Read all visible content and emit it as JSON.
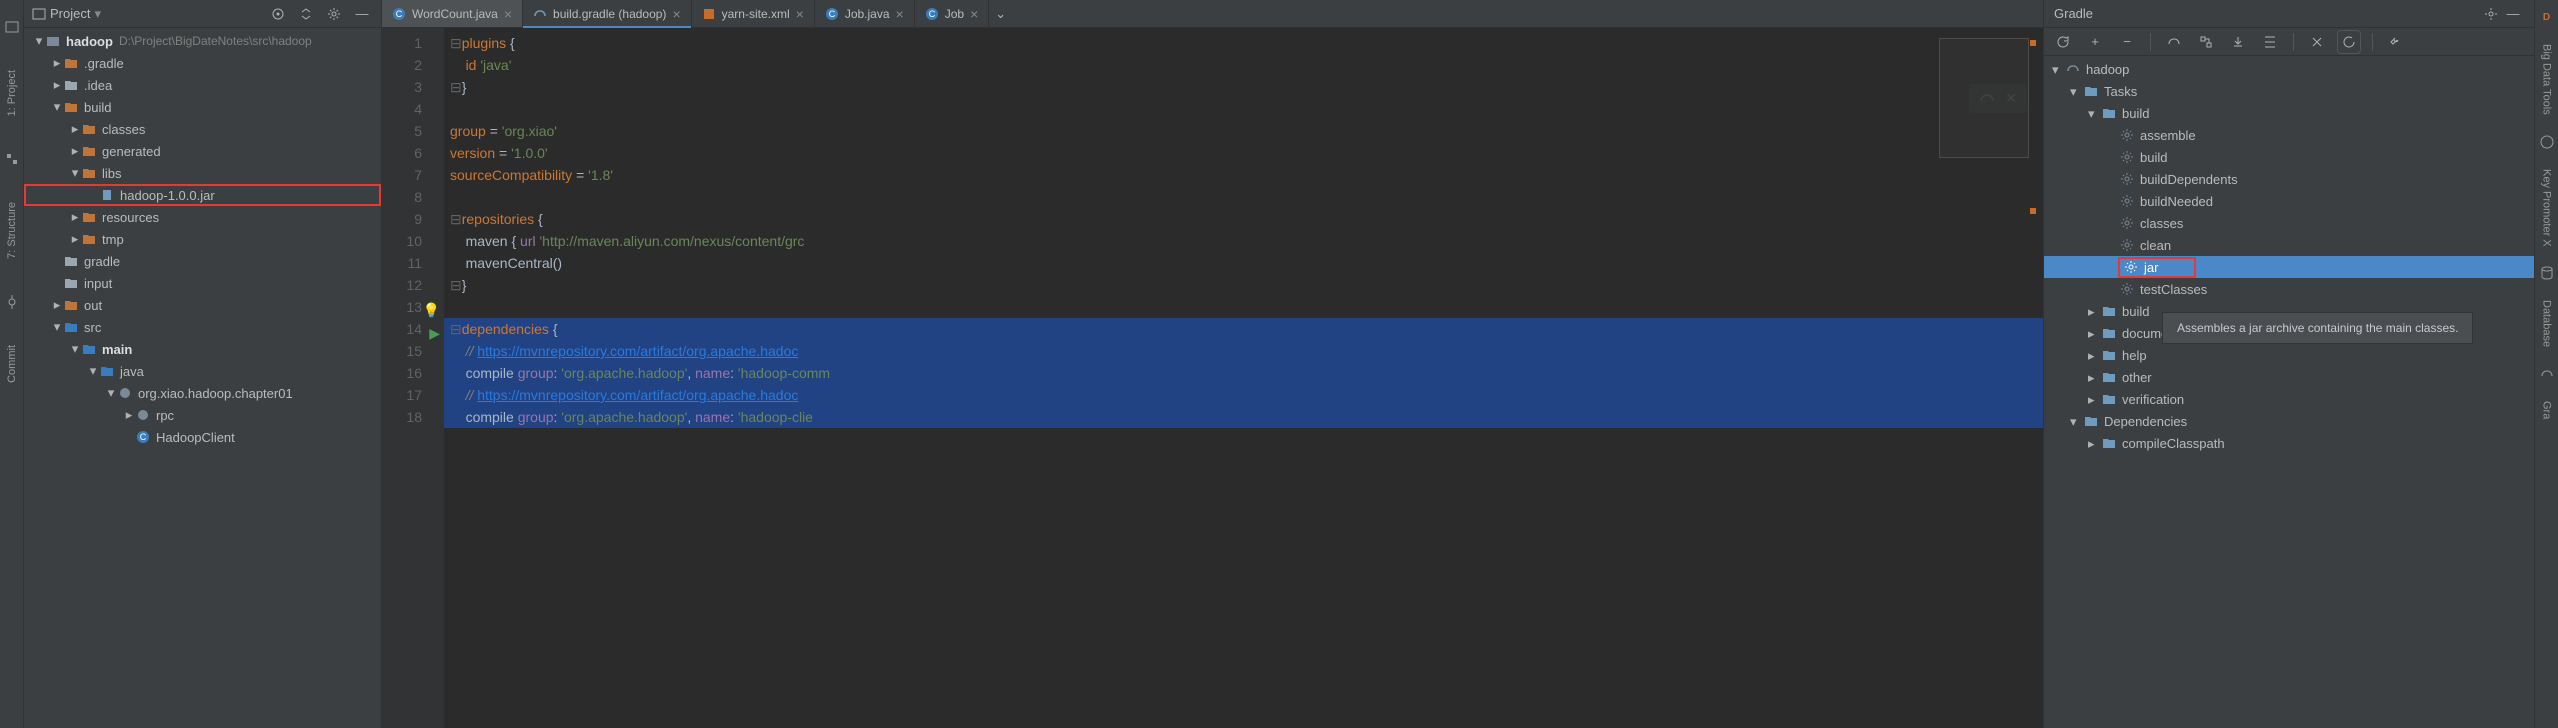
{
  "leftStripe": {
    "project": "1: Project",
    "structure": "7: Structure",
    "commit": "Commit"
  },
  "projectPanel": {
    "title": "Project",
    "root": {
      "name": "hadoop",
      "path": "D:\\Project\\BigDateNotes\\src\\hadoop"
    },
    "tree": [
      {
        "depth": 1,
        "exp": "right",
        "icon": "folder",
        "label": ".gradle",
        "color": "#c07437"
      },
      {
        "depth": 1,
        "exp": "right",
        "icon": "folder",
        "label": ".idea",
        "color": "#9aa7b0"
      },
      {
        "depth": 1,
        "exp": "down",
        "icon": "folder",
        "label": "build",
        "color": "#c07437"
      },
      {
        "depth": 2,
        "exp": "right",
        "icon": "folder",
        "label": "classes",
        "color": "#c07437"
      },
      {
        "depth": 2,
        "exp": "right",
        "icon": "folder",
        "label": "generated",
        "color": "#c07437"
      },
      {
        "depth": 2,
        "exp": "down",
        "icon": "folder",
        "label": "libs",
        "color": "#c07437"
      },
      {
        "depth": 3,
        "exp": "none",
        "icon": "jar",
        "label": "hadoop-1.0.0.jar",
        "hl": true
      },
      {
        "depth": 2,
        "exp": "right",
        "icon": "folder",
        "label": "resources",
        "color": "#c07437"
      },
      {
        "depth": 2,
        "exp": "right",
        "icon": "folder",
        "label": "tmp",
        "color": "#c07437"
      },
      {
        "depth": 1,
        "exp": "",
        "icon": "folder",
        "label": "gradle",
        "color": "#9aa7b0"
      },
      {
        "depth": 1,
        "exp": "",
        "icon": "folder",
        "label": "input",
        "color": "#9aa7b0"
      },
      {
        "depth": 1,
        "exp": "right",
        "icon": "folder",
        "label": "out",
        "color": "#c07437"
      },
      {
        "depth": 1,
        "exp": "down",
        "icon": "source",
        "label": "src",
        "color": "#3a7dbf"
      },
      {
        "depth": 2,
        "exp": "down",
        "icon": "source",
        "label": "main",
        "color": "#3a7dbf",
        "bold": true
      },
      {
        "depth": 3,
        "exp": "down",
        "icon": "source",
        "label": "java",
        "color": "#3a7dbf"
      },
      {
        "depth": 4,
        "exp": "down",
        "icon": "package",
        "label": "org.xiao.hadoop.chapter01"
      },
      {
        "depth": 5,
        "exp": "right",
        "icon": "package",
        "label": "rpc"
      },
      {
        "depth": 5,
        "exp": "none",
        "icon": "class",
        "label": "HadoopClient"
      }
    ]
  },
  "tabs": [
    {
      "icon": "class",
      "label": "WordCount.java",
      "active": true
    },
    {
      "icon": "gradle",
      "label": "build.gradle (hadoop)",
      "underline": true
    },
    {
      "icon": "xml",
      "label": "yarn-site.xml"
    },
    {
      "icon": "class",
      "label": "Job.java"
    },
    {
      "icon": "class",
      "label": "Job"
    }
  ],
  "code": {
    "lines": [
      {
        "n": 1,
        "html": "<span class='fold'>⊟</span><span class='kw'>plugins</span> <span class='plain'>{</span>"
      },
      {
        "n": 2,
        "html": "    <span class='kw'>id</span> <span class='str'>'java'</span>"
      },
      {
        "n": 3,
        "html": "<span class='fold'>⊟</span><span class='plain'>}</span>"
      },
      {
        "n": 4,
        "html": ""
      },
      {
        "n": 5,
        "html": "<span class='kw'>group</span> <span class='plain'>=</span> <span class='str'>'org.xiao'</span>"
      },
      {
        "n": 6,
        "html": "<span class='kw'>version</span> <span class='plain'>=</span> <span class='str'>'1.0.0'</span>"
      },
      {
        "n": 7,
        "html": "<span class='kw'>sourceCompatibility</span> <span class='plain'>=</span> <span class='str'>'1.8'</span>"
      },
      {
        "n": 8,
        "html": ""
      },
      {
        "n": 9,
        "html": "<span class='fold'>⊟</span><span class='kw'>repositories</span> <span class='plain'>{</span>"
      },
      {
        "n": 10,
        "html": "    <span class='plain'>maven { </span><span class='id'>url</span> <span class='str'>'http://maven.aliyun.com/nexus/content/grc</span>"
      },
      {
        "n": 11,
        "html": "    <span class='plain'>mavenCentral()</span>"
      },
      {
        "n": 12,
        "html": "<span class='fold'>⊟</span><span class='plain'>}</span>"
      },
      {
        "n": 13,
        "html": "",
        "bulb": true
      },
      {
        "n": 14,
        "html": "<span class='fold'>⊟</span><span class='kw'>dependencies</span> <span class='plain'>{</span>",
        "play": true,
        "sel": true
      },
      {
        "n": 15,
        "html": "    <span class='com'>// </span><span class='lnk'>https://mvnrepository.com/artifact/org.apache.hadoc</span>",
        "sel": true
      },
      {
        "n": 16,
        "html": "    <span class='plain'>compile </span><span class='id'>group</span><span class='plain'>: </span><span class='str'>'org.apache.hadoop'</span><span class='plain'>, </span><span class='id'>name</span><span class='plain'>: </span><span class='str'>'hadoop-comm</span>",
        "sel": true
      },
      {
        "n": 17,
        "html": "    <span class='com'>// </span><span class='lnk'>https://mvnrepository.com/artifact/org.apache.hadoc</span>",
        "sel": true
      },
      {
        "n": 18,
        "html": "    <span class='plain'>compile </span><span class='id'>group</span><span class='plain'>: </span><span class='str'>'org.apache.hadoop'</span><span class='plain'>, </span><span class='id'>name</span><span class='plain'>: </span><span class='str'>'hadoop-clie</span>",
        "sel": true
      }
    ]
  },
  "gradle": {
    "title": "Gradle",
    "tree": [
      {
        "depth": 0,
        "exp": "down",
        "icon": "elephant",
        "label": "hadoop"
      },
      {
        "depth": 1,
        "exp": "down",
        "icon": "folder-gear",
        "label": "Tasks"
      },
      {
        "depth": 2,
        "exp": "down",
        "icon": "folder-gear",
        "label": "build"
      },
      {
        "depth": 3,
        "icon": "gear",
        "label": "assemble"
      },
      {
        "depth": 3,
        "icon": "gear",
        "label": "build"
      },
      {
        "depth": 3,
        "icon": "gear",
        "label": "buildDependents"
      },
      {
        "depth": 3,
        "icon": "gear",
        "label": "buildNeeded"
      },
      {
        "depth": 3,
        "icon": "gear",
        "label": "classes"
      },
      {
        "depth": 3,
        "icon": "gear",
        "label": "clean"
      },
      {
        "depth": 3,
        "icon": "gear",
        "label": "jar",
        "selected": true,
        "box": true
      },
      {
        "depth": 3,
        "icon": "gear",
        "label": "testClasses"
      },
      {
        "depth": 2,
        "exp": "right",
        "icon": "folder-gear",
        "label": "build"
      },
      {
        "depth": 2,
        "exp": "right",
        "icon": "folder-gear",
        "label": "documentation"
      },
      {
        "depth": 2,
        "exp": "right",
        "icon": "folder-gear",
        "label": "help"
      },
      {
        "depth": 2,
        "exp": "right",
        "icon": "folder-gear",
        "label": "other"
      },
      {
        "depth": 2,
        "exp": "right",
        "icon": "folder-gear",
        "label": "verification"
      },
      {
        "depth": 1,
        "exp": "down",
        "icon": "folder-gear",
        "label": "Dependencies"
      },
      {
        "depth": 2,
        "exp": "right",
        "icon": "folder-gear",
        "label": "compileClasspath"
      }
    ],
    "tooltip": "Assembles a jar archive containing the main classes."
  },
  "rightStripe": {
    "bigdata": "Big Data Tools",
    "keypromo": "Key Promoter X",
    "database": "Database",
    "gradle": "Gra"
  }
}
